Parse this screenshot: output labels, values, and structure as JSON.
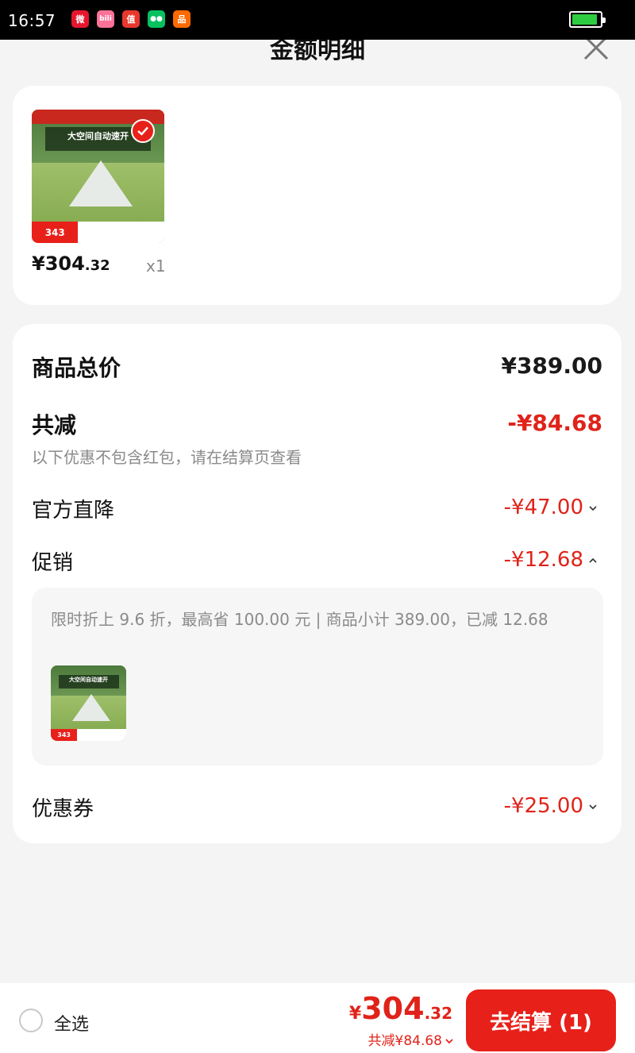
{
  "status_bar": {
    "time": "16:57",
    "battery_level": 0.9,
    "apps": [
      {
        "name": "weibo-icon",
        "glyph": "微",
        "color": "#e6162d"
      },
      {
        "name": "bilibili-icon",
        "glyph": "bili",
        "color": "#fb7299"
      },
      {
        "name": "zhide-icon",
        "glyph": "值",
        "color": "#e8382d"
      },
      {
        "name": "wechat-icon",
        "glyph": "●●",
        "color": "#07c160"
      },
      {
        "name": "app-icon",
        "glyph": "品",
        "color": "#ff6a00"
      }
    ]
  },
  "header": {
    "title": "金额明细"
  },
  "product": {
    "thumb_banner": "大空间自动速开",
    "thumb_price": "343",
    "price_int": "¥304",
    "price_dec": ".32",
    "quantity": "x1"
  },
  "details": {
    "total_label": "商品总价",
    "total_value": "¥389.00",
    "reduce_label": "共减",
    "reduce_value": "-¥84.68",
    "hint": "以下优惠不包含红包，请在结算页查看",
    "official_label": "官方直降",
    "official_value": "-¥47.00",
    "promo_label": "促销",
    "promo_value": "-¥12.68",
    "promo_desc": "限时折上 9.6 折，最高省 100.00 元 | 商品小计 389.00，已减 12.68",
    "coupon_label": "优惠券",
    "coupon_value": "-¥25.00"
  },
  "bottom": {
    "select_all": "全选",
    "total_currency": "¥",
    "total_int": "304",
    "total_dec": ".32",
    "saving": "共减¥84.68",
    "checkout": "去结算 (1)"
  },
  "colors": {
    "accent": "#e8201a",
    "price_red": "#e0231a"
  }
}
